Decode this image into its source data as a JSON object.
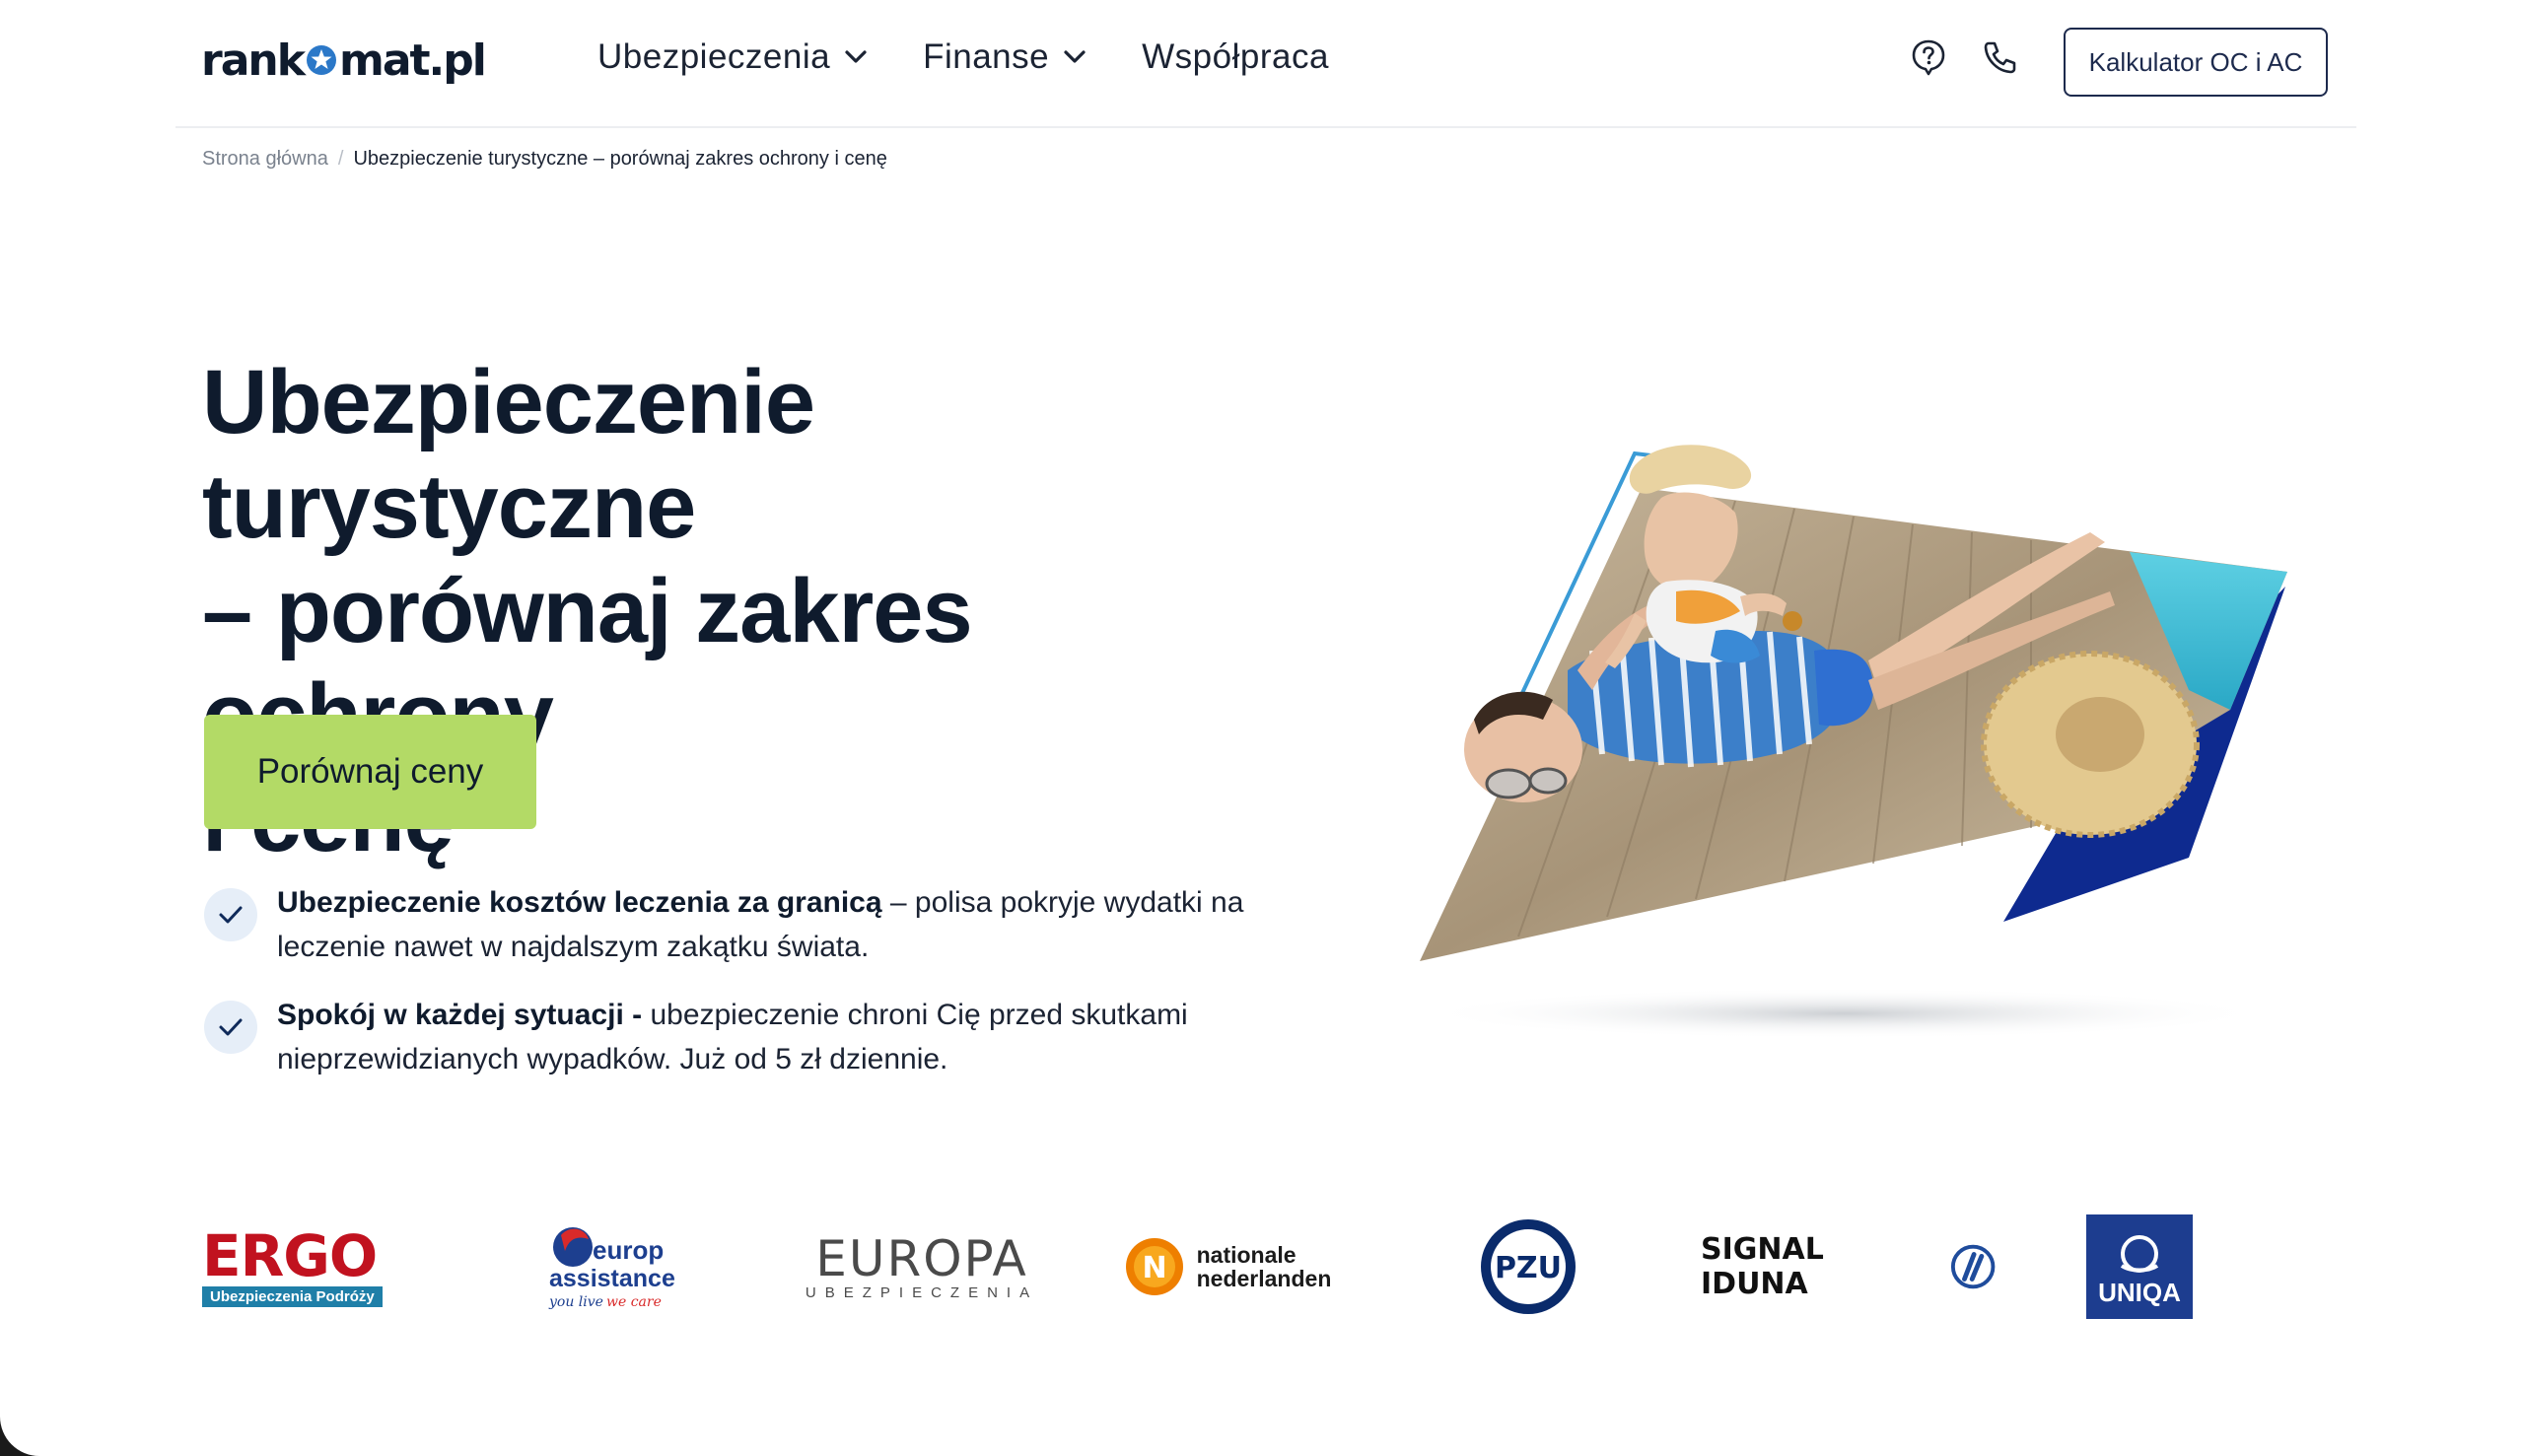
{
  "header": {
    "logo_left": "rank",
    "logo_right": "mat.pl",
    "nav": [
      {
        "label": "Ubezpieczenia",
        "has_dropdown": true
      },
      {
        "label": "Finanse",
        "has_dropdown": true
      },
      {
        "label": "Współpraca",
        "has_dropdown": false
      }
    ],
    "calc_button": "Kalkulator OC i AC"
  },
  "breadcrumb": {
    "home": "Strona główna",
    "separator": "/",
    "current": "Ubezpieczenie turystyczne – porównaj zakres ochrony i cenę"
  },
  "hero": {
    "title_line1": "Ubezpieczenie turystyczne",
    "title_line2": "– porównaj zakres ochrony",
    "title_line3": "i cenę",
    "cta": "Porównaj ceny",
    "benefits": [
      {
        "bold": "Ubezpieczenie kosztów leczenia za granicą",
        "text": " – polisa pokryje wydatki na leczenie nawet w najdalszym zakątku świata."
      },
      {
        "bold": "Spokój w każdej sytuacji -",
        "text": " ubezpieczenie chroni Cię przed skutkami nieprzewidzianych wypadków. Już od 5 zł dziennie."
      }
    ]
  },
  "partners": {
    "ergo": {
      "name": "ERGO",
      "sub": "Ubezpieczenia Podróży"
    },
    "europ": {
      "line1": "europ",
      "line2": "assistance",
      "tag1": "you live",
      "tag2": "we care"
    },
    "europa": {
      "name": "EUROPA",
      "sub": "UBEZPIECZENIA"
    },
    "nn": {
      "line1": "nationale",
      "line2": "nederlanden"
    },
    "pzu": {
      "name": "PZU"
    },
    "signal": {
      "name": "SIGNAL IDUNA"
    },
    "uniqa": {
      "name": "UNIQA"
    }
  },
  "colors": {
    "navy": "#0f1b2d",
    "cta_green": "#b3da66",
    "accent_blue": "#1e6cd6",
    "brand_dark_blue": "#0e2a8f"
  },
  "icons": {
    "help": "help-question-icon",
    "phone": "phone-icon",
    "check": "check-icon",
    "chevron": "chevron-down-icon"
  }
}
